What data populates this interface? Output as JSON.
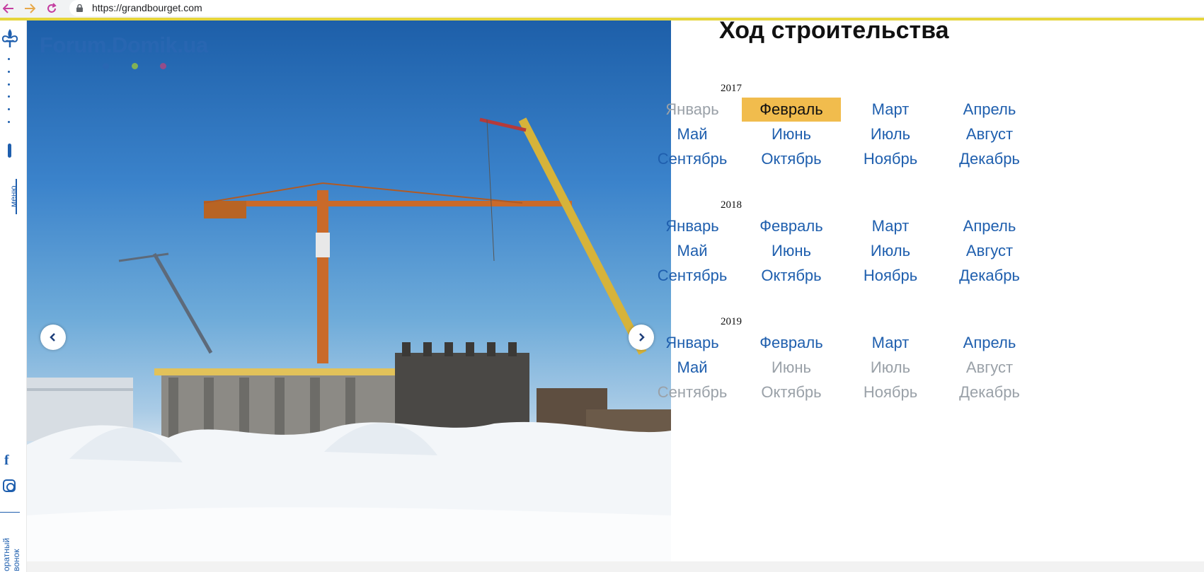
{
  "browser": {
    "url": "https://grandbourget.com",
    "icons": [
      "back-arrow-icon",
      "forward-arrow-icon",
      "reload-icon",
      "lock-icon"
    ]
  },
  "sidebar": {
    "menu_label": "меню",
    "social": [
      "facebook-icon",
      "instagram-icon"
    ],
    "callback_line1": "оратный",
    "callback_line2": "вонок"
  },
  "gallery": {
    "watermark": "Forum.Domik.ua",
    "watermark_dot_colors": [
      "#2b67b3",
      "#9ac43d",
      "#b2467f"
    ],
    "prev_icon": "chevron-left-icon",
    "next_icon": "chevron-right-icon"
  },
  "content": {
    "title": "Ход строительства",
    "years": [
      {
        "year": "2017",
        "months": [
          {
            "label": "Январь",
            "state": "disabled"
          },
          {
            "label": "Февраль",
            "state": "active"
          },
          {
            "label": "Март",
            "state": "link"
          },
          {
            "label": "Апрель",
            "state": "link"
          },
          {
            "label": "Май",
            "state": "link"
          },
          {
            "label": "Июнь",
            "state": "link"
          },
          {
            "label": "Июль",
            "state": "link"
          },
          {
            "label": "Август",
            "state": "link"
          },
          {
            "label": "Сентябрь",
            "state": "link"
          },
          {
            "label": "Октябрь",
            "state": "link"
          },
          {
            "label": "Ноябрь",
            "state": "link"
          },
          {
            "label": "Декабрь",
            "state": "link"
          }
        ]
      },
      {
        "year": "2018",
        "months": [
          {
            "label": "Январь",
            "state": "link"
          },
          {
            "label": "Февраль",
            "state": "link"
          },
          {
            "label": "Март",
            "state": "link"
          },
          {
            "label": "Апрель",
            "state": "link"
          },
          {
            "label": "Май",
            "state": "link"
          },
          {
            "label": "Июнь",
            "state": "link"
          },
          {
            "label": "Июль",
            "state": "link"
          },
          {
            "label": "Август",
            "state": "link"
          },
          {
            "label": "Сентябрь",
            "state": "link"
          },
          {
            "label": "Октябрь",
            "state": "link"
          },
          {
            "label": "Ноябрь",
            "state": "link"
          },
          {
            "label": "Декабрь",
            "state": "link"
          }
        ]
      },
      {
        "year": "2019",
        "months": [
          {
            "label": "Январь",
            "state": "link"
          },
          {
            "label": "Февраль",
            "state": "link"
          },
          {
            "label": "Март",
            "state": "link"
          },
          {
            "label": "Апрель",
            "state": "link"
          },
          {
            "label": "Май",
            "state": "link"
          },
          {
            "label": "Июнь",
            "state": "disabled"
          },
          {
            "label": "Июль",
            "state": "disabled"
          },
          {
            "label": "Август",
            "state": "disabled"
          },
          {
            "label": "Сентябрь",
            "state": "disabled"
          },
          {
            "label": "Октябрь",
            "state": "disabled"
          },
          {
            "label": "Ноябрь",
            "state": "disabled"
          },
          {
            "label": "Декабрь",
            "state": "disabled"
          }
        ]
      }
    ]
  },
  "colors": {
    "accent_blue": "#1f5fae",
    "active_month_bg": "#f1bc4d",
    "disabled_month": "#9aa1a8",
    "browser_accent": "#e6d53c"
  }
}
